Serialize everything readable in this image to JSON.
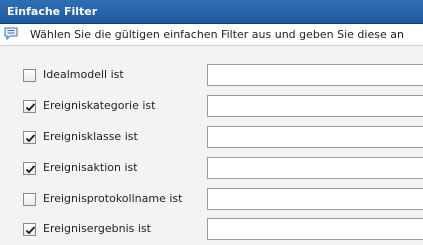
{
  "panel": {
    "title": "Einfache Filter"
  },
  "info": {
    "icon": "info-speech-icon",
    "text": "Wählen Sie die gültigen einfachen Filter aus und geben Sie diese an"
  },
  "filters": [
    {
      "label": "Idealmodell ist",
      "checked": false,
      "value": ""
    },
    {
      "label": "Ereigniskategorie ist",
      "checked": true,
      "value": ""
    },
    {
      "label": "Ereignisklasse ist",
      "checked": true,
      "value": ""
    },
    {
      "label": "Ereignisaktion ist",
      "checked": true,
      "value": ""
    },
    {
      "label": "Ereignisprotokollname ist",
      "checked": false,
      "value": ""
    },
    {
      "label": "Ereignisergebnis ist",
      "checked": true,
      "value": ""
    }
  ]
}
